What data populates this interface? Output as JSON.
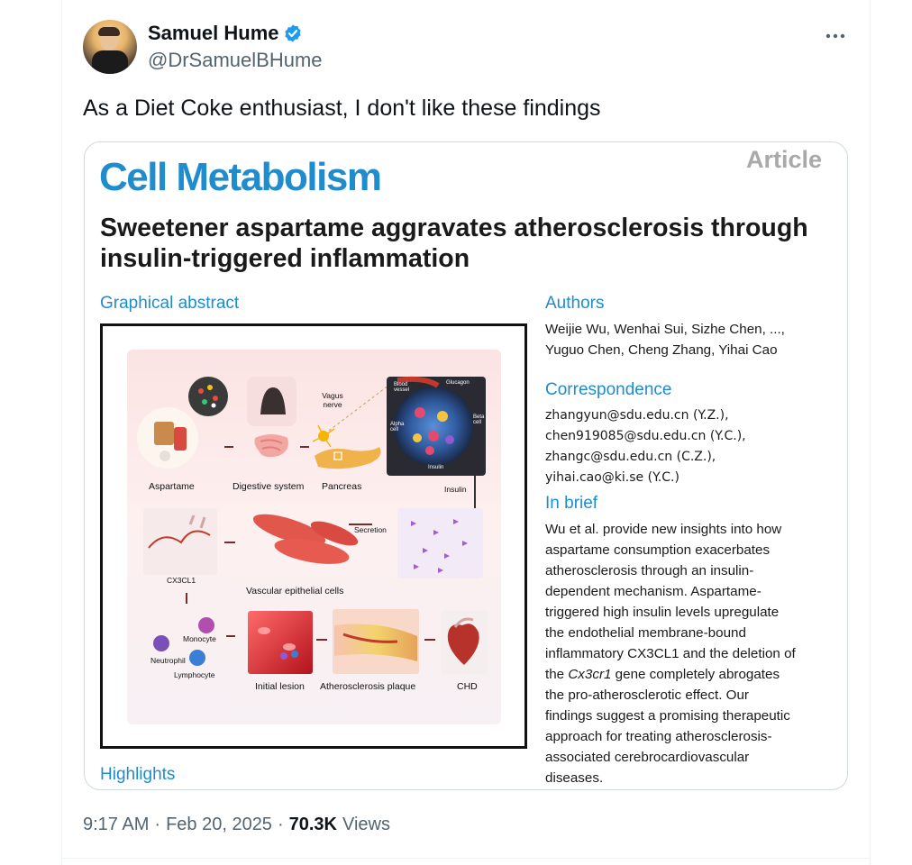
{
  "author": {
    "name": "Samuel Hume",
    "handle": "@DrSamuelBHume",
    "verified": true,
    "verified_color": "#1d9bf0"
  },
  "more_icon": "more-horizontal-icon",
  "tweet": {
    "text": "As a Diet Coke enthusiast, I don't like these findings"
  },
  "card": {
    "article_tag": "Article",
    "journal": "Cell Metabolism",
    "title": "Sweetener aspartame aggravates atherosclerosis through insulin-triggered inflammation",
    "graphical_abstract_label": "Graphical abstract",
    "highlights_label": "Highlights",
    "abstract_labels": {
      "aspartame": "Aspartame",
      "digestive": "Digestive system",
      "pancreas": "Pancreas",
      "vagus": "Vagus nerve",
      "blood_vessel": "Blood vessel",
      "glucagon": "Glucagon",
      "beta_cell": "Beta cell",
      "alpha_cell": "Alpha cell",
      "insulin_small": "Insulin",
      "insulin": "Insulin",
      "secretion": "Secretion",
      "cx3cl1": "CX3CL1",
      "vascular": "Vascular epithelial cells",
      "monocyte": "Monocyte",
      "neutrophil": "Neutrophil",
      "lymphocyte": "Lymphocyte",
      "initial_lesion": "Initial lesion",
      "plaque": "Atherosclerosis plaque",
      "chd": "CHD"
    },
    "authors": {
      "title": "Authors",
      "lines": [
        "Weijie Wu, Wenhai Sui, Sizhe Chen, ...,",
        "Yuguo Chen, Cheng Zhang, Yihai Cao"
      ]
    },
    "correspondence": {
      "title": "Correspondence",
      "lines": [
        "zhangyun@sdu.edu.cn (Y.Z.),",
        "chen919085@sdu.edu.cn (Y.C.),",
        "zhangc@sdu.edu.cn (C.Z.),",
        "yihai.cao@ki.se (Y.C.)"
      ]
    },
    "in_brief": {
      "title": "In brief",
      "lines": [
        "Wu et al. provide new insights into how",
        "aspartame consumption exacerbates",
        "atherosclerosis through an insulin-",
        "dependent mechanism. Aspartame-",
        "triggered high insulin levels upregulate",
        "the endothelial membrane-bound",
        "inflammatory CX3CL1 and the deletion of",
        "the Cx3cr1 gene completely abrogates",
        "the pro-atherosclerotic effect. Our",
        "findings suggest a promising therapeutic",
        "approach for treating atherosclerosis-",
        "associated cerebrocardiovascular",
        "diseases."
      ]
    }
  },
  "meta": {
    "time": "9:17 AM",
    "sep1": "·",
    "date": "Feb 20, 2025",
    "sep2": "·",
    "views_count": "70.3K",
    "views_label": "Views"
  },
  "colors": {
    "journal_blue": "#1f8ccd",
    "text_secondary": "#536471",
    "border": "#cfd9de"
  }
}
